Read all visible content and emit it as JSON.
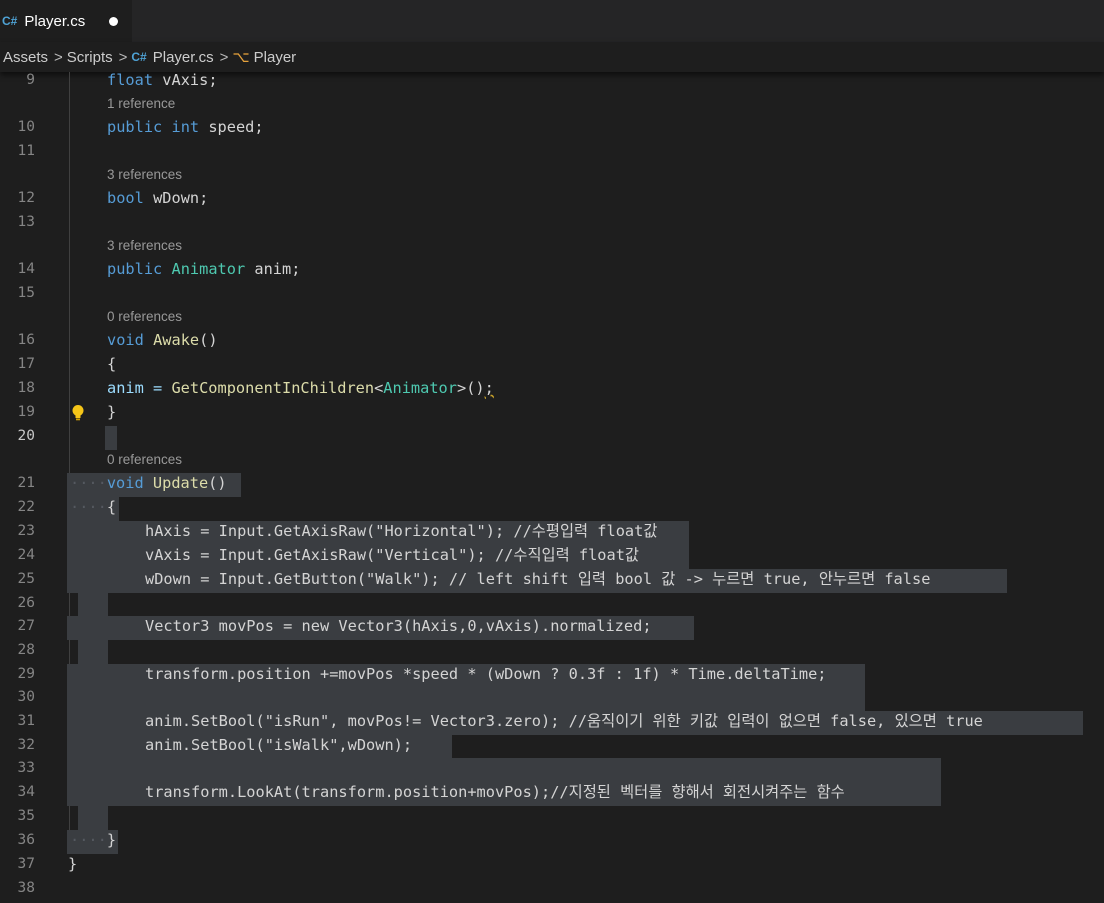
{
  "tab": {
    "label": "Player.cs",
    "icon": "csharp-file-icon",
    "unsaved_dot": true
  },
  "breadcrumb": {
    "items": [
      "Assets",
      "Scripts",
      "Player.cs",
      "Player"
    ],
    "separator": ">"
  },
  "colors": {
    "keyword": "#569cd6",
    "type": "#4ec9b0",
    "function": "#dcdcaa",
    "variable": "#9cdcfe",
    "string": "#ce9178",
    "number": "#b5cea8",
    "comment": "#6a9955",
    "selection": "#3a3d41"
  },
  "code": {
    "line_numbers": [
      "9",
      "10",
      "11",
      "12",
      "13",
      "14",
      "15",
      "16",
      "17",
      "18",
      "19",
      "20",
      "21",
      "22",
      "23",
      "24",
      "25",
      "26",
      "27",
      "28",
      "29",
      "30",
      "31",
      "32",
      "33",
      "34",
      "35",
      "36",
      "37",
      "38"
    ],
    "code_lens": {
      "speed": "1 reference",
      "wDown": "3 references",
      "anim": "3 references",
      "awake": "0 references",
      "update": "0 references"
    },
    "tokens": {
      "float": "float",
      "public": "public",
      "int": "int",
      "bool": "bool",
      "void": "void",
      "new": "new",
      "Animator": "Animator",
      "Vector3": "Vector3",
      "vAxis_decl": "vAxis;",
      "speed_decl": "speed;",
      "wDown_decl": "wDown;",
      "anim_decl": "anim;",
      "Awake": "Awake",
      "Update": "Update",
      "open_brace": "{",
      "close_brace": "}",
      "l18_a": "anim = ",
      "l18_fn": "GetComponentInChildren",
      "l18_lt": "<",
      "l18_gt": ">()",
      "l18_semi": ";",
      "l23": "hAxis = Input.GetAxisRaw(\"Horizontal\"); //수평입력 float값",
      "l24": "vAxis = Input.GetAxisRaw(\"Vertical\"); //수직입력 float값",
      "l25": "wDown = Input.GetButton(\"Walk\"); // left shift 입력 bool 값 -> 누르면 true, 안누르면 false",
      "l27": "Vector3 movPos = new Vector3(hAxis,0,vAxis).normalized;",
      "l29": "transform.position +=movPos *speed * (wDown ? 0.3f : 1f) * Time.deltaTime;",
      "l31": "anim.SetBool(\"isRun\", movPos!= Vector3.zero); //움직이기 위한 키값 입력이 없으면 false, 있으면 true",
      "l32": "anim.SetBool(\"isWalk\",wDown);",
      "l34": "transform.LookAt(transform.position+movPos);//지정된 벡터를 향해서 회전시켜주는 함수",
      "parens": "()"
    }
  }
}
